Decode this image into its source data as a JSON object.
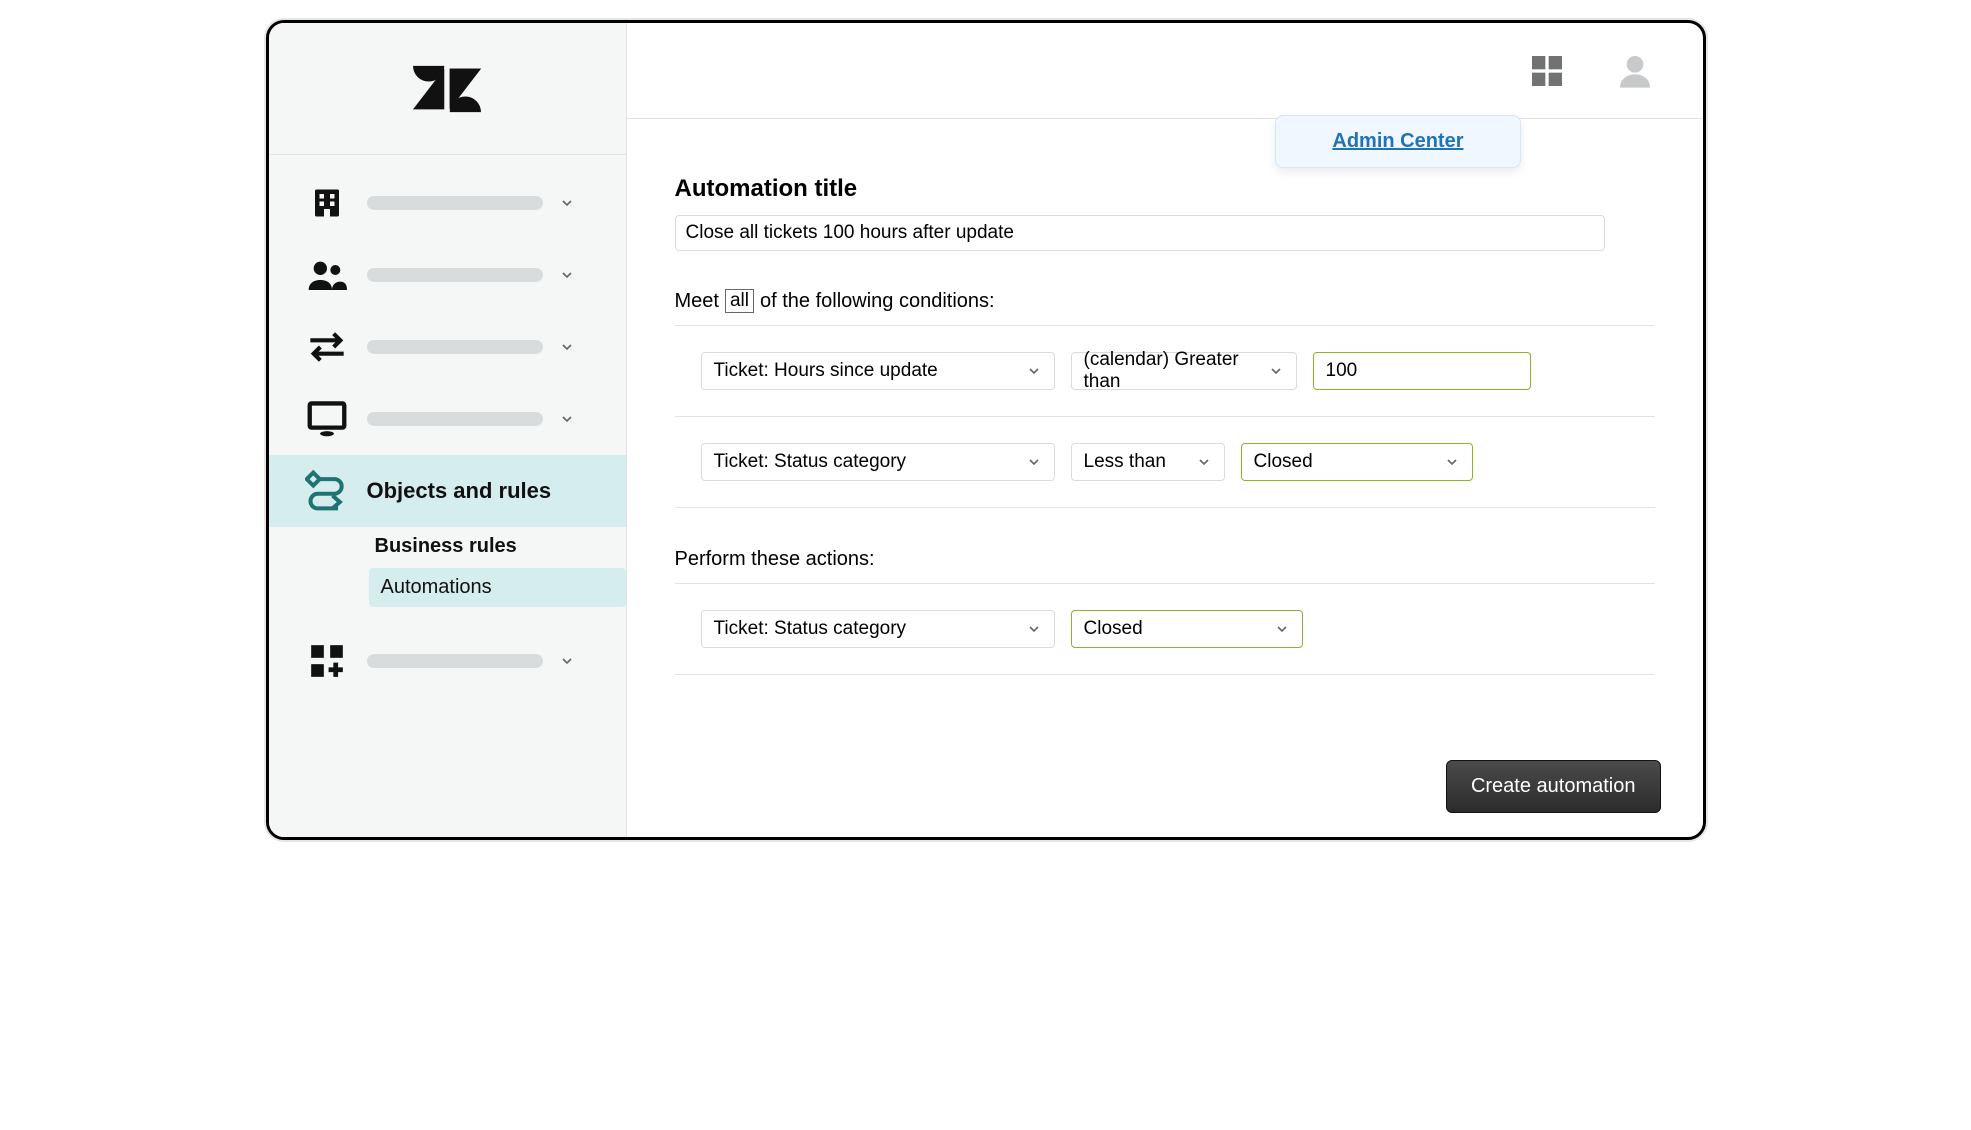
{
  "sidebar": {
    "active_label": "Objects and rules",
    "subnav": {
      "heading": "Business rules",
      "selected": "Automations"
    }
  },
  "topbar": {
    "tooltip_link": "Admin Center"
  },
  "form": {
    "title_label": "Automation title",
    "title_value": "Close all tickets 100 hours after update",
    "meet_pre": "Meet",
    "meet_tag": "all",
    "meet_post": "of the following conditions:",
    "conditions": [
      {
        "field": "Ticket: Hours since update",
        "operator": "(calendar) Greater than",
        "value": "100",
        "value_type": "text"
      },
      {
        "field": "Ticket: Status category",
        "operator": "Less than",
        "value": "Closed",
        "value_type": "select"
      }
    ],
    "actions_label": "Perform these actions:",
    "actions": [
      {
        "field": "Ticket: Status category",
        "value": "Closed"
      }
    ],
    "submit_label": "Create automation"
  }
}
